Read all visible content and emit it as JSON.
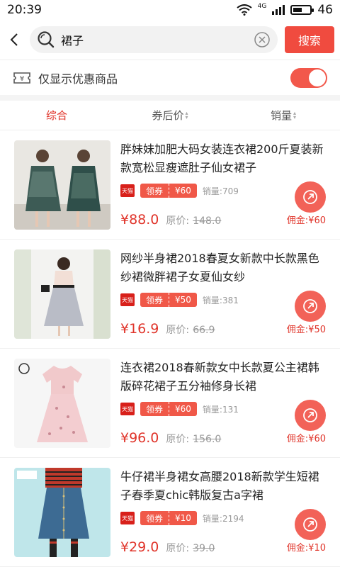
{
  "status": {
    "time": "20:39",
    "network": "4G",
    "battery": "46"
  },
  "search": {
    "query": "裙子",
    "button_label": "搜索"
  },
  "filter": {
    "label": "仅显示优惠商品",
    "enabled": true
  },
  "sort_tabs": [
    {
      "label": "综合",
      "active": true
    },
    {
      "label": "券后价"
    },
    {
      "label": "销量"
    }
  ],
  "products": [
    {
      "title": "胖妹妹加肥大码女装连衣裙200斤夏装新款宽松显瘦遮肚子仙女裙子",
      "coupon_label": "领券",
      "coupon_value": "¥60",
      "sales": "销量:709",
      "price": "¥88.0",
      "orig_label": "原价:",
      "orig_price": "148.0",
      "commission": "佣金:¥60",
      "shop_badge": "天猫"
    },
    {
      "title": "网纱半身裙2018春夏女新款中长款黑色纱裙微胖裙子女夏仙女纱",
      "coupon_label": "领券",
      "coupon_value": "¥50",
      "sales": "销量:381",
      "price": "¥16.9",
      "orig_label": "原价:",
      "orig_price": "66.9",
      "commission": "佣金:¥50",
      "shop_badge": "天猫"
    },
    {
      "title": "连衣裙2018春新款女中长款夏公主裙韩版碎花裙子五分袖修身长裙",
      "coupon_label": "领券",
      "coupon_value": "¥60",
      "sales": "销量:131",
      "price": "¥96.0",
      "orig_label": "原价:",
      "orig_price": "156.0",
      "commission": "佣金:¥60",
      "shop_badge": "天猫"
    },
    {
      "title": "牛仔裙半身裙女高腰2018新款学生短裙子春季夏chic韩版复古a字裙",
      "coupon_label": "领券",
      "coupon_value": "¥10",
      "sales": "销量:2194",
      "price": "¥29.0",
      "orig_label": "原价:",
      "orig_price": "39.0",
      "commission": "佣金:¥10",
      "shop_badge": "天猫"
    }
  ],
  "colors": {
    "accent": "#f04b3f",
    "price": "#e0342a"
  }
}
